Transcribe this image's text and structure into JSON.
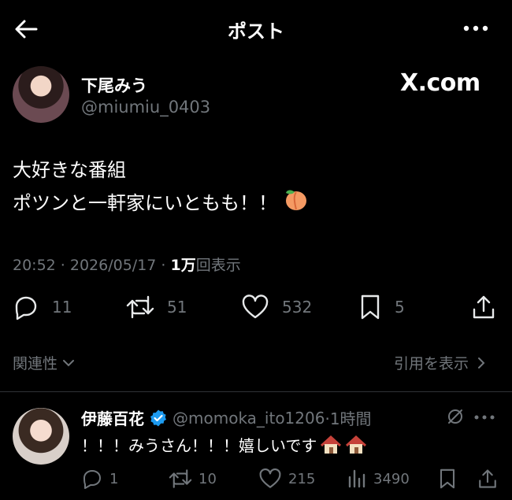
{
  "header": {
    "title": "ポスト"
  },
  "post": {
    "author_name": "下尾みう",
    "author_handle": "@miumiu_0403",
    "watermark": "X.com",
    "lines": [
      "大好きな番組",
      "ポツンと一軒家にいともも！！"
    ],
    "time": "20:52 · 2026/05/17 · ",
    "views_count": "1万",
    "views_label": "回表示",
    "stats": {
      "replies": "11",
      "reposts": "51",
      "likes": "532",
      "bookmarks": "5"
    }
  },
  "related": {
    "left_label": "関連性",
    "right_label": "引用を表示"
  },
  "reply": {
    "author_name": "伊藤百花",
    "author_handle": "@momoka_ito1206",
    "time": "·1時間",
    "text": "！！！みうさん！！！嬉しいです",
    "stats": {
      "replies": "1",
      "reposts": "10",
      "likes": "215",
      "views": "3490"
    }
  },
  "colors": {
    "background": "#000000",
    "text": "#e7e9ea",
    "secondary": "#71767b",
    "verified": "#1d9bf0",
    "divider": "#2f3336"
  }
}
